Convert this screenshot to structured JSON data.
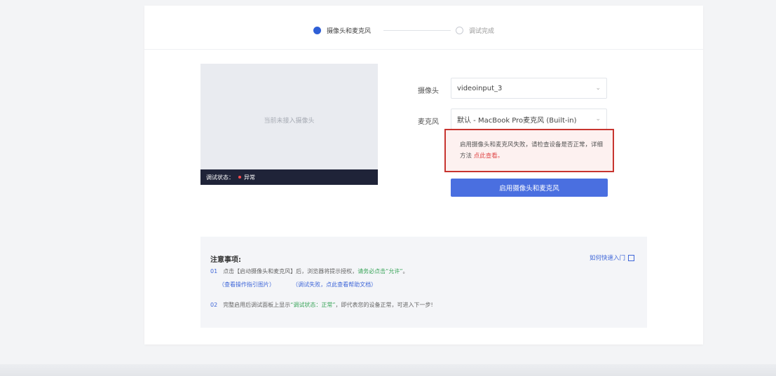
{
  "steps": {
    "step1_label": "摄像头和麦克风",
    "step2_label": "调试完成"
  },
  "preview": {
    "placeholder": "当前未接入摄像头",
    "status_label": "调试状态：",
    "status_value": "异常"
  },
  "form": {
    "camera_label": "摄像头",
    "camera_value": "videoinput_3",
    "mic_label": "麦克风",
    "mic_value": "默认 - MacBook Pro麦克风 (Built-in)"
  },
  "alert": {
    "message": "启用摄像头和麦克风失败，请检查设备是否正常，详细方法",
    "link": "点此查看。"
  },
  "enable_button": "启用摄像头和麦克风",
  "notes": {
    "title": "注意事项:",
    "link": "如何快速入门",
    "item1_num": "01",
    "item1_text": "点击【启动摄像头和麦克风】后，浏览器将提示授权，",
    "item1_green": "请务必点击“允许”",
    "item1_close": "。",
    "item1_link_a": "（查看操作指引图片）",
    "item1_link_b": "（调试失败，点此查看帮助文档）",
    "item2_num": "02",
    "item2_text_a": "完整启用后调试面板上显示",
    "item2_green": "“调试状态：正常”",
    "item2_text_b": "，即代表您的设备正常，可进入下一步!"
  },
  "colors": {
    "primary": "#4a6fe0",
    "alert_border": "#c7342f",
    "status_error": "#ff4d4f",
    "success_text": "#3aa55a"
  }
}
